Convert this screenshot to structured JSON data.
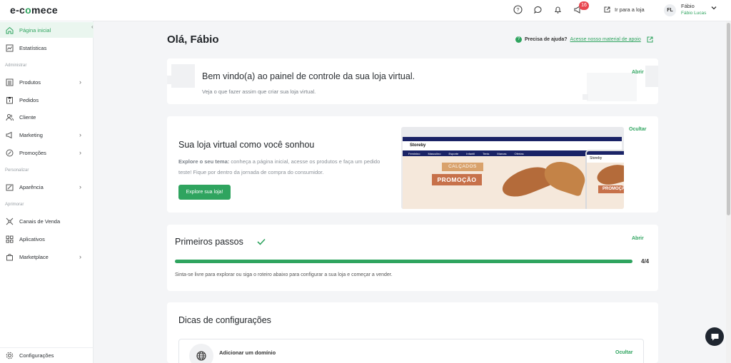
{
  "app": {
    "logo_prefix": "e-c",
    "logo_accent": "o",
    "logo_suffix": "mece"
  },
  "topbar": {
    "notification_count": "16",
    "go_store_label": "Ir para a loja",
    "avatar_initials": "FL",
    "user_name": "Fábio",
    "user_store": "Fábio Lucas"
  },
  "sidebar": {
    "items": [
      {
        "label": "Página inicial",
        "icon": "home-icon"
      },
      {
        "label": "Estatísticas",
        "icon": "chart-icon"
      },
      {
        "label": "Produtos",
        "icon": "products-icon"
      },
      {
        "label": "Pedidos",
        "icon": "orders-icon"
      },
      {
        "label": "Cliente",
        "icon": "clients-icon"
      },
      {
        "label": "Marketing",
        "icon": "megaphone-icon"
      },
      {
        "label": "Promoções",
        "icon": "percent-icon"
      },
      {
        "label": "Aparência",
        "icon": "brush-icon"
      },
      {
        "label": "Canais de Venda",
        "icon": "channels-icon"
      },
      {
        "label": "Aplicativos",
        "icon": "apps-icon"
      },
      {
        "label": "Marketplace",
        "icon": "bag-icon"
      },
      {
        "label": "Configurações",
        "icon": "gear-icon"
      }
    ],
    "sections": {
      "administrar": "Administrar",
      "personalizar": "Personalizar",
      "aprimorar": "Aprimorar"
    }
  },
  "main": {
    "greeting": "Olá, Fábio",
    "help_label": "Precisa de ajuda?",
    "help_link": "Acesse nosso material de apoio",
    "welcome": {
      "title": "Bem vindo(a) ao painel de controle da sua loja virtual.",
      "subtitle": "Veja o que fazer assim que criar sua loja virtual.",
      "action": "Abrir"
    },
    "dream": {
      "title": "Sua loja virtual como você sonhou",
      "text_bold": "Explore o seu tema:",
      "text": " conheça a página inicial, acesse os produtos e faça um pedido teste! Fique por dentro da jornada de compra do consumidor.",
      "button": "Explore sua loja!",
      "action": "Ocultar",
      "preview_brand": "Storeby",
      "preview_tag": "CALÇADOS",
      "preview_promo": "PROMOÇÃO",
      "preview_nav": [
        "Feminino",
        "Masculino",
        "Esporte",
        "Infantil",
        "Tenis",
        "Marcas",
        "Ofertas"
      ]
    },
    "steps": {
      "title": "Primeiros passos",
      "action": "Abrir",
      "progress_text": "4/4",
      "progress_fraction": 1.0,
      "description": "Sinta-se livre para explorar ou siga o roteiro abaixo para configurar a sua loja e começar a vender."
    },
    "tips": {
      "title": "Dicas de configurações",
      "item_label": "Adicionar um domínio",
      "item_action": "Ocultar"
    }
  },
  "colors": {
    "accent": "#2fa45f",
    "navy": "#1a2366"
  }
}
